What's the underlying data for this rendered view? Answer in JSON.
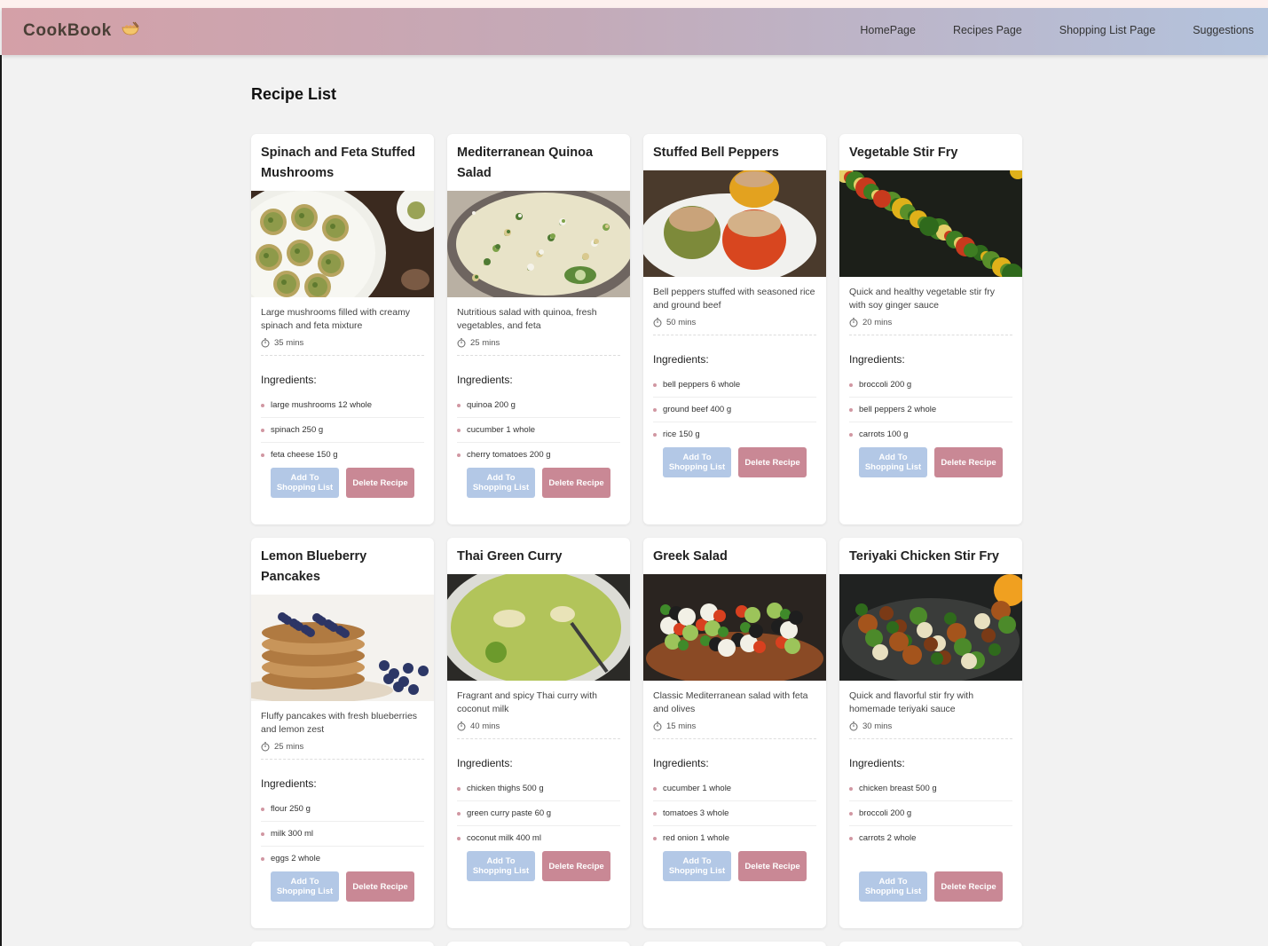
{
  "app": {
    "brand": "CookBook",
    "nav": [
      "HomePage",
      "Recipes Page",
      "Shopping List Page",
      "Suggestions"
    ]
  },
  "page": {
    "title": "Recipe List"
  },
  "labels": {
    "ingredients": "Ingredients:",
    "add_button": "Add To Shopping List",
    "delete_button": "Delete Recipe"
  },
  "colors": {
    "accent_pink": "#c98895",
    "accent_blue": "#b3c8e6"
  },
  "recipes": [
    {
      "title": "Spinach and Feta Stuffed Mushrooms",
      "image": "stuffed-mushrooms-photo",
      "desc": "Large mushrooms filled with creamy spinach and feta mixture",
      "time": "35 mins",
      "ingredients": [
        "large mushrooms 12 whole",
        "spinach 250 g",
        "feta cheese 150 g"
      ]
    },
    {
      "title": "Mediterranean Quinoa Salad",
      "image": "quinoa-salad-photo",
      "desc": "Nutritious salad with quinoa, fresh vegetables, and feta",
      "time": "25 mins",
      "ingredients": [
        "quinoa 200 g",
        "cucumber 1 whole",
        "cherry tomatoes 200 g"
      ]
    },
    {
      "title": "Stuffed Bell Peppers",
      "image": "stuffed-peppers-photo",
      "desc": "Bell peppers stuffed with seasoned rice and ground beef",
      "time": "50 mins",
      "ingredients": [
        "bell peppers 6 whole",
        "ground beef 400 g",
        "rice 150 g"
      ]
    },
    {
      "title": "Vegetable Stir Fry",
      "image": "stir-fry-photo",
      "desc": "Quick and healthy vegetable stir fry with soy ginger sauce",
      "time": "20 mins",
      "ingredients": [
        "broccoli 200 g",
        "bell peppers 2 whole",
        "carrots 100 g"
      ]
    },
    {
      "title": "Lemon Blueberry Pancakes",
      "image": "pancakes-photo",
      "desc": "Fluffy pancakes with fresh blueberries and lemon zest",
      "time": "25 mins",
      "ingredients": [
        "flour 250 g",
        "milk 300 ml",
        "eggs 2 whole"
      ]
    },
    {
      "title": "Thai Green Curry",
      "image": "green-curry-photo",
      "desc": "Fragrant and spicy Thai curry with coconut milk",
      "time": "40 mins",
      "ingredients": [
        "chicken thighs 500 g",
        "green curry paste 60 g",
        "coconut milk 400 ml"
      ]
    },
    {
      "title": "Greek Salad",
      "image": "greek-salad-photo",
      "desc": "Classic Mediterranean salad with feta and olives",
      "time": "15 mins",
      "ingredients": [
        "cucumber 1 whole",
        "tomatoes 3 whole",
        "red onion 1 whole"
      ]
    },
    {
      "title": "Teriyaki Chicken Stir Fry",
      "image": "teriyaki-photo",
      "desc": "Quick and flavorful stir fry with homemade teriyaki sauce",
      "time": "30 mins",
      "ingredients": [
        "chicken breast 500 g",
        "broccoli 200 g",
        "carrots 2 whole"
      ]
    }
  ]
}
